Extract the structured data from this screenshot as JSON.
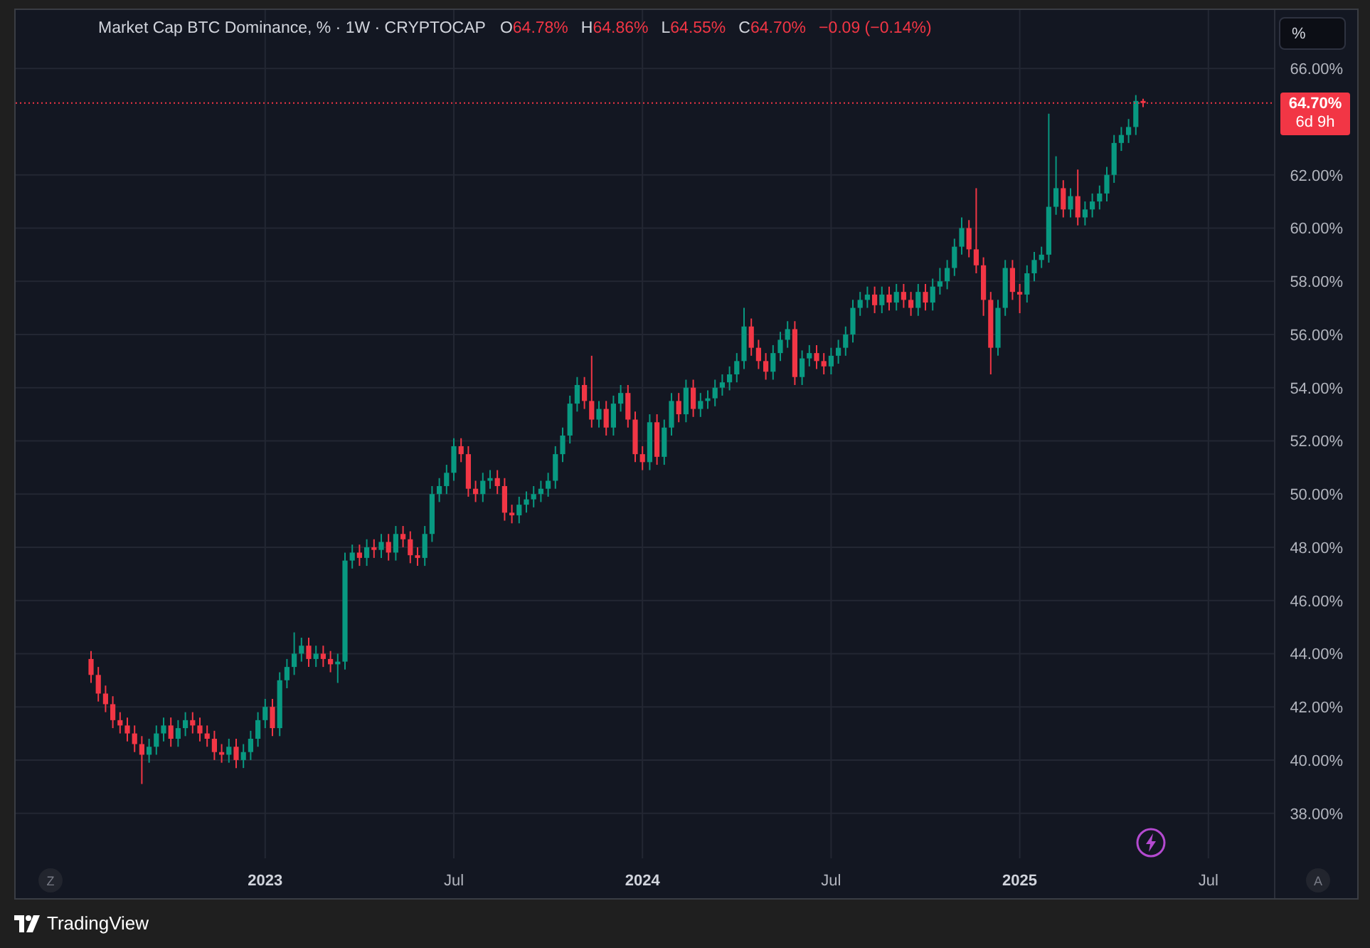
{
  "legend": {
    "title": "Market Cap BTC Dominance, % · 1W · CRYPTOCAP",
    "color": "#f23645",
    "ohlc": [
      {
        "label": "O",
        "value": "64.78%"
      },
      {
        "label": "H",
        "value": "64.86%"
      },
      {
        "label": "L",
        "value": "64.55%"
      },
      {
        "label": "C",
        "value": "64.70%"
      }
    ],
    "change": "−0.09 (−0.14%)"
  },
  "scale_button": {
    "label": "%"
  },
  "price_label": {
    "price": "64.70%",
    "countdown": "6d 9h",
    "color": "#f23645"
  },
  "chart": {
    "chart_data": {
      "type": "candlestick",
      "ylim": [
        34.7,
        68.2
      ],
      "grid": true,
      "yticks": [
        {
          "value": 38,
          "label": "38.00%"
        },
        {
          "value": 40,
          "label": "40.00%"
        },
        {
          "value": 42,
          "label": "42.00%"
        },
        {
          "value": 44,
          "label": "44.00%"
        },
        {
          "value": 46,
          "label": "46.00%"
        },
        {
          "value": 48,
          "label": "48.00%"
        },
        {
          "value": 50,
          "label": "50.00%"
        },
        {
          "value": 52,
          "label": "52.00%"
        },
        {
          "value": 54,
          "label": "54.00%"
        },
        {
          "value": 56,
          "label": "56.00%"
        },
        {
          "value": 58,
          "label": "58.00%"
        },
        {
          "value": 60,
          "label": "60.00%"
        },
        {
          "value": 62,
          "label": "62.00%"
        },
        {
          "value": 66,
          "label": "66.00%"
        }
      ],
      "ref_lines": [
        {
          "axis": "y",
          "value": 64.7,
          "color": "#f23645"
        }
      ],
      "categories": [
        null,
        null,
        null,
        null,
        null,
        null,
        null,
        null,
        null,
        null,
        null,
        null,
        null,
        null,
        null,
        null,
        null,
        null,
        null,
        null,
        null,
        null,
        null,
        null,
        "2023",
        null,
        null,
        null,
        null,
        null,
        null,
        null,
        null,
        null,
        null,
        null,
        null,
        null,
        null,
        null,
        null,
        null,
        null,
        null,
        null,
        null,
        null,
        null,
        null,
        null,
        "Jul",
        null,
        null,
        null,
        null,
        null,
        null,
        null,
        null,
        null,
        null,
        null,
        null,
        null,
        null,
        null,
        null,
        null,
        null,
        null,
        null,
        null,
        null,
        null,
        null,
        null,
        "2024",
        null,
        null,
        null,
        null,
        null,
        null,
        null,
        null,
        null,
        null,
        null,
        null,
        null,
        null,
        null,
        null,
        null,
        null,
        null,
        null,
        null,
        null,
        null,
        null,
        null,
        "Jul",
        null,
        null,
        null,
        null,
        null,
        null,
        null,
        null,
        null,
        null,
        null,
        null,
        null,
        null,
        null,
        null,
        null,
        null,
        null,
        null,
        null,
        null,
        null,
        null,
        null,
        "2025",
        null,
        null,
        null,
        null,
        null,
        null,
        null,
        null,
        null,
        null,
        null,
        null,
        null,
        null,
        null,
        null,
        null,
        null,
        null,
        null,
        null,
        null,
        null,
        null,
        null,
        "Jul"
      ],
      "ohlc": [
        [
          43.8,
          44.1,
          42.9,
          43.2
        ],
        [
          43.2,
          43.5,
          42.2,
          42.5
        ],
        [
          42.5,
          42.8,
          41.8,
          42.1
        ],
        [
          42.1,
          42.4,
          41.2,
          41.5
        ],
        [
          41.5,
          41.8,
          41,
          41.3
        ],
        [
          41.3,
          41.6,
          40.7,
          41
        ],
        [
          41,
          41.3,
          40.3,
          40.6
        ],
        [
          40.6,
          40.9,
          39.1,
          40.2
        ],
        [
          40.2,
          40.8,
          39.9,
          40.5
        ],
        [
          40.5,
          41.3,
          40.2,
          41
        ],
        [
          41,
          41.6,
          40.7,
          41.3
        ],
        [
          41.3,
          41.6,
          40.5,
          40.8
        ],
        [
          40.8,
          41.5,
          40.5,
          41.2
        ],
        [
          41.2,
          41.8,
          40.9,
          41.5
        ],
        [
          41.5,
          41.8,
          41,
          41.3
        ],
        [
          41.3,
          41.6,
          40.7,
          41
        ],
        [
          41,
          41.3,
          40.5,
          40.8
        ],
        [
          40.8,
          41.1,
          40,
          40.3
        ],
        [
          40.3,
          40.6,
          39.9,
          40.2
        ],
        [
          40.2,
          40.8,
          39.9,
          40.5
        ],
        [
          40.5,
          40.8,
          39.7,
          40
        ],
        [
          40,
          40.6,
          39.7,
          40.3
        ],
        [
          40.3,
          41.1,
          40,
          40.8
        ],
        [
          40.8,
          41.8,
          40.5,
          41.5
        ],
        [
          41.5,
          42.3,
          41.2,
          42
        ],
        [
          42,
          42.3,
          40.9,
          41.2
        ],
        [
          41.2,
          43.3,
          40.9,
          43
        ],
        [
          43,
          43.8,
          42.7,
          43.5
        ],
        [
          43.5,
          44.8,
          43.2,
          44
        ],
        [
          44,
          44.6,
          43.7,
          44.3
        ],
        [
          44.3,
          44.6,
          43.5,
          43.8
        ],
        [
          43.8,
          44.3,
          43.5,
          44
        ],
        [
          44,
          44.3,
          43.5,
          43.8
        ],
        [
          43.8,
          44.1,
          43.3,
          43.6
        ],
        [
          43.6,
          44,
          42.9,
          43.7
        ],
        [
          43.7,
          47.8,
          43.4,
          47.5
        ],
        [
          47.5,
          48.1,
          47.2,
          47.8
        ],
        [
          47.8,
          48.1,
          47.3,
          47.6
        ],
        [
          47.6,
          48.3,
          47.3,
          48
        ],
        [
          48,
          48.3,
          47.6,
          47.9
        ],
        [
          47.9,
          48.5,
          47.6,
          48.2
        ],
        [
          48.2,
          48.5,
          47.5,
          47.8
        ],
        [
          47.8,
          48.8,
          47.5,
          48.5
        ],
        [
          48.5,
          48.8,
          48,
          48.3
        ],
        [
          48.3,
          48.6,
          47.4,
          47.7
        ],
        [
          47.7,
          48,
          47.3,
          47.6
        ],
        [
          47.6,
          48.8,
          47.3,
          48.5
        ],
        [
          48.5,
          50.3,
          48.2,
          50
        ],
        [
          50,
          50.6,
          49.7,
          50.3
        ],
        [
          50.3,
          51.1,
          50,
          50.8
        ],
        [
          50.8,
          52.1,
          50.5,
          51.8
        ],
        [
          51.8,
          52.1,
          51.2,
          51.5
        ],
        [
          51.5,
          51.8,
          49.9,
          50.2
        ],
        [
          50.2,
          50.5,
          49.7,
          50
        ],
        [
          50,
          50.8,
          49.7,
          50.5
        ],
        [
          50.5,
          50.9,
          50.2,
          50.6
        ],
        [
          50.6,
          50.9,
          50,
          50.3
        ],
        [
          50.3,
          50.6,
          49,
          49.3
        ],
        [
          49.3,
          49.6,
          48.9,
          49.2
        ],
        [
          49.2,
          49.9,
          48.9,
          49.6
        ],
        [
          49.6,
          50.1,
          49.3,
          49.8
        ],
        [
          49.8,
          50.3,
          49.5,
          50
        ],
        [
          50,
          50.5,
          49.7,
          50.2
        ],
        [
          50.2,
          50.8,
          49.9,
          50.5
        ],
        [
          50.5,
          51.8,
          50.2,
          51.5
        ],
        [
          51.5,
          52.5,
          51.2,
          52.2
        ],
        [
          52.2,
          53.7,
          51.9,
          53.4
        ],
        [
          53.4,
          54.4,
          53.1,
          54.1
        ],
        [
          54.1,
          54.4,
          53.2,
          53.5
        ],
        [
          53.5,
          55.2,
          52.5,
          52.8
        ],
        [
          52.8,
          53.5,
          52.5,
          53.2
        ],
        [
          53.2,
          53.5,
          52.2,
          52.5
        ],
        [
          52.5,
          53.7,
          52.2,
          53.4
        ],
        [
          53.4,
          54.1,
          53.1,
          53.8
        ],
        [
          53.8,
          54.1,
          52.5,
          52.8
        ],
        [
          52.8,
          53.1,
          51.2,
          51.5
        ],
        [
          51.5,
          51.8,
          50.9,
          51.2
        ],
        [
          51.2,
          53,
          50.9,
          52.7
        ],
        [
          52.7,
          53,
          51.1,
          51.4
        ],
        [
          51.4,
          52.8,
          51.1,
          52.5
        ],
        [
          52.5,
          53.8,
          52.2,
          53.5
        ],
        [
          53.5,
          53.8,
          52.7,
          53
        ],
        [
          53,
          54.3,
          52.7,
          54
        ],
        [
          54,
          54.3,
          52.9,
          53.2
        ],
        [
          53.2,
          53.8,
          52.9,
          53.5
        ],
        [
          53.5,
          53.9,
          53.2,
          53.6
        ],
        [
          53.6,
          54.3,
          53.3,
          54
        ],
        [
          54,
          54.5,
          53.7,
          54.2
        ],
        [
          54.2,
          54.8,
          53.9,
          54.5
        ],
        [
          54.5,
          55.3,
          54.2,
          55
        ],
        [
          55,
          57,
          54.7,
          56.3
        ],
        [
          56.3,
          56.6,
          55.2,
          55.5
        ],
        [
          55.5,
          55.8,
          54.7,
          55
        ],
        [
          55,
          55.3,
          54.3,
          54.6
        ],
        [
          54.6,
          55.6,
          54.3,
          55.3
        ],
        [
          55.3,
          56.1,
          55,
          55.8
        ],
        [
          55.8,
          56.5,
          55.5,
          56.2
        ],
        [
          56.2,
          56.5,
          54.1,
          54.4
        ],
        [
          54.4,
          55.4,
          54.1,
          55.1
        ],
        [
          55.1,
          55.6,
          54.8,
          55.3
        ],
        [
          55.3,
          55.6,
          54.7,
          55
        ],
        [
          55,
          55.3,
          54.5,
          54.8
        ],
        [
          54.8,
          55.5,
          54.5,
          55.2
        ],
        [
          55.2,
          55.8,
          54.9,
          55.5
        ],
        [
          55.5,
          56.3,
          55.2,
          56
        ],
        [
          56,
          57.3,
          55.7,
          57
        ],
        [
          57,
          57.6,
          56.7,
          57.3
        ],
        [
          57.3,
          57.8,
          57,
          57.5
        ],
        [
          57.5,
          57.8,
          56.8,
          57.1
        ],
        [
          57.1,
          57.8,
          56.8,
          57.5
        ],
        [
          57.5,
          57.8,
          56.9,
          57.2
        ],
        [
          57.2,
          57.9,
          56.9,
          57.6
        ],
        [
          57.6,
          57.9,
          57,
          57.3
        ],
        [
          57.3,
          57.6,
          56.7,
          57
        ],
        [
          57,
          57.9,
          56.7,
          57.6
        ],
        [
          57.6,
          57.9,
          56.9,
          57.2
        ],
        [
          57.2,
          58.1,
          56.9,
          57.8
        ],
        [
          57.8,
          58.5,
          57.5,
          58
        ],
        [
          58,
          58.8,
          57.7,
          58.5
        ],
        [
          58.5,
          59.6,
          58.2,
          59.3
        ],
        [
          59.3,
          60.4,
          59,
          60
        ],
        [
          60,
          60.3,
          58.9,
          59.2
        ],
        [
          59.2,
          61.5,
          58.3,
          58.6
        ],
        [
          58.6,
          58.9,
          56.7,
          57.3
        ],
        [
          57.3,
          57.6,
          54.5,
          55.5
        ],
        [
          55.5,
          57.3,
          55.2,
          57
        ],
        [
          57,
          58.8,
          56.7,
          58.5
        ],
        [
          58.5,
          58.8,
          57.3,
          57.6
        ],
        [
          57.6,
          57.9,
          56.8,
          57.5
        ],
        [
          57.5,
          58.6,
          57.2,
          58.3
        ],
        [
          58.3,
          59.1,
          58,
          58.8
        ],
        [
          58.8,
          59.3,
          58.5,
          59
        ],
        [
          59,
          64.3,
          58.7,
          60.8
        ],
        [
          60.8,
          62.7,
          60.5,
          61.5
        ],
        [
          61.5,
          61.8,
          60.4,
          60.7
        ],
        [
          60.7,
          61.5,
          60.4,
          61.2
        ],
        [
          61.2,
          62.2,
          60.1,
          60.4
        ],
        [
          60.4,
          61,
          60.1,
          60.7
        ],
        [
          60.7,
          61.3,
          60.4,
          61
        ],
        [
          61,
          61.6,
          60.7,
          61.3
        ],
        [
          61.3,
          62.3,
          61,
          62
        ],
        [
          62,
          63.5,
          61.7,
          63.2
        ],
        [
          63.2,
          63.8,
          62.9,
          63.5
        ],
        [
          63.5,
          64.1,
          63.2,
          63.8
        ],
        [
          63.8,
          65,
          63.5,
          64.78
        ],
        [
          64.78,
          64.86,
          64.55,
          64.7
        ],
        null,
        null,
        null,
        null,
        null,
        null,
        null,
        null,
        null
      ]
    }
  },
  "corner_buttons": [
    {
      "label": "Z"
    },
    {
      "label": "A"
    }
  ],
  "brand": {
    "name": "TradingView"
  }
}
